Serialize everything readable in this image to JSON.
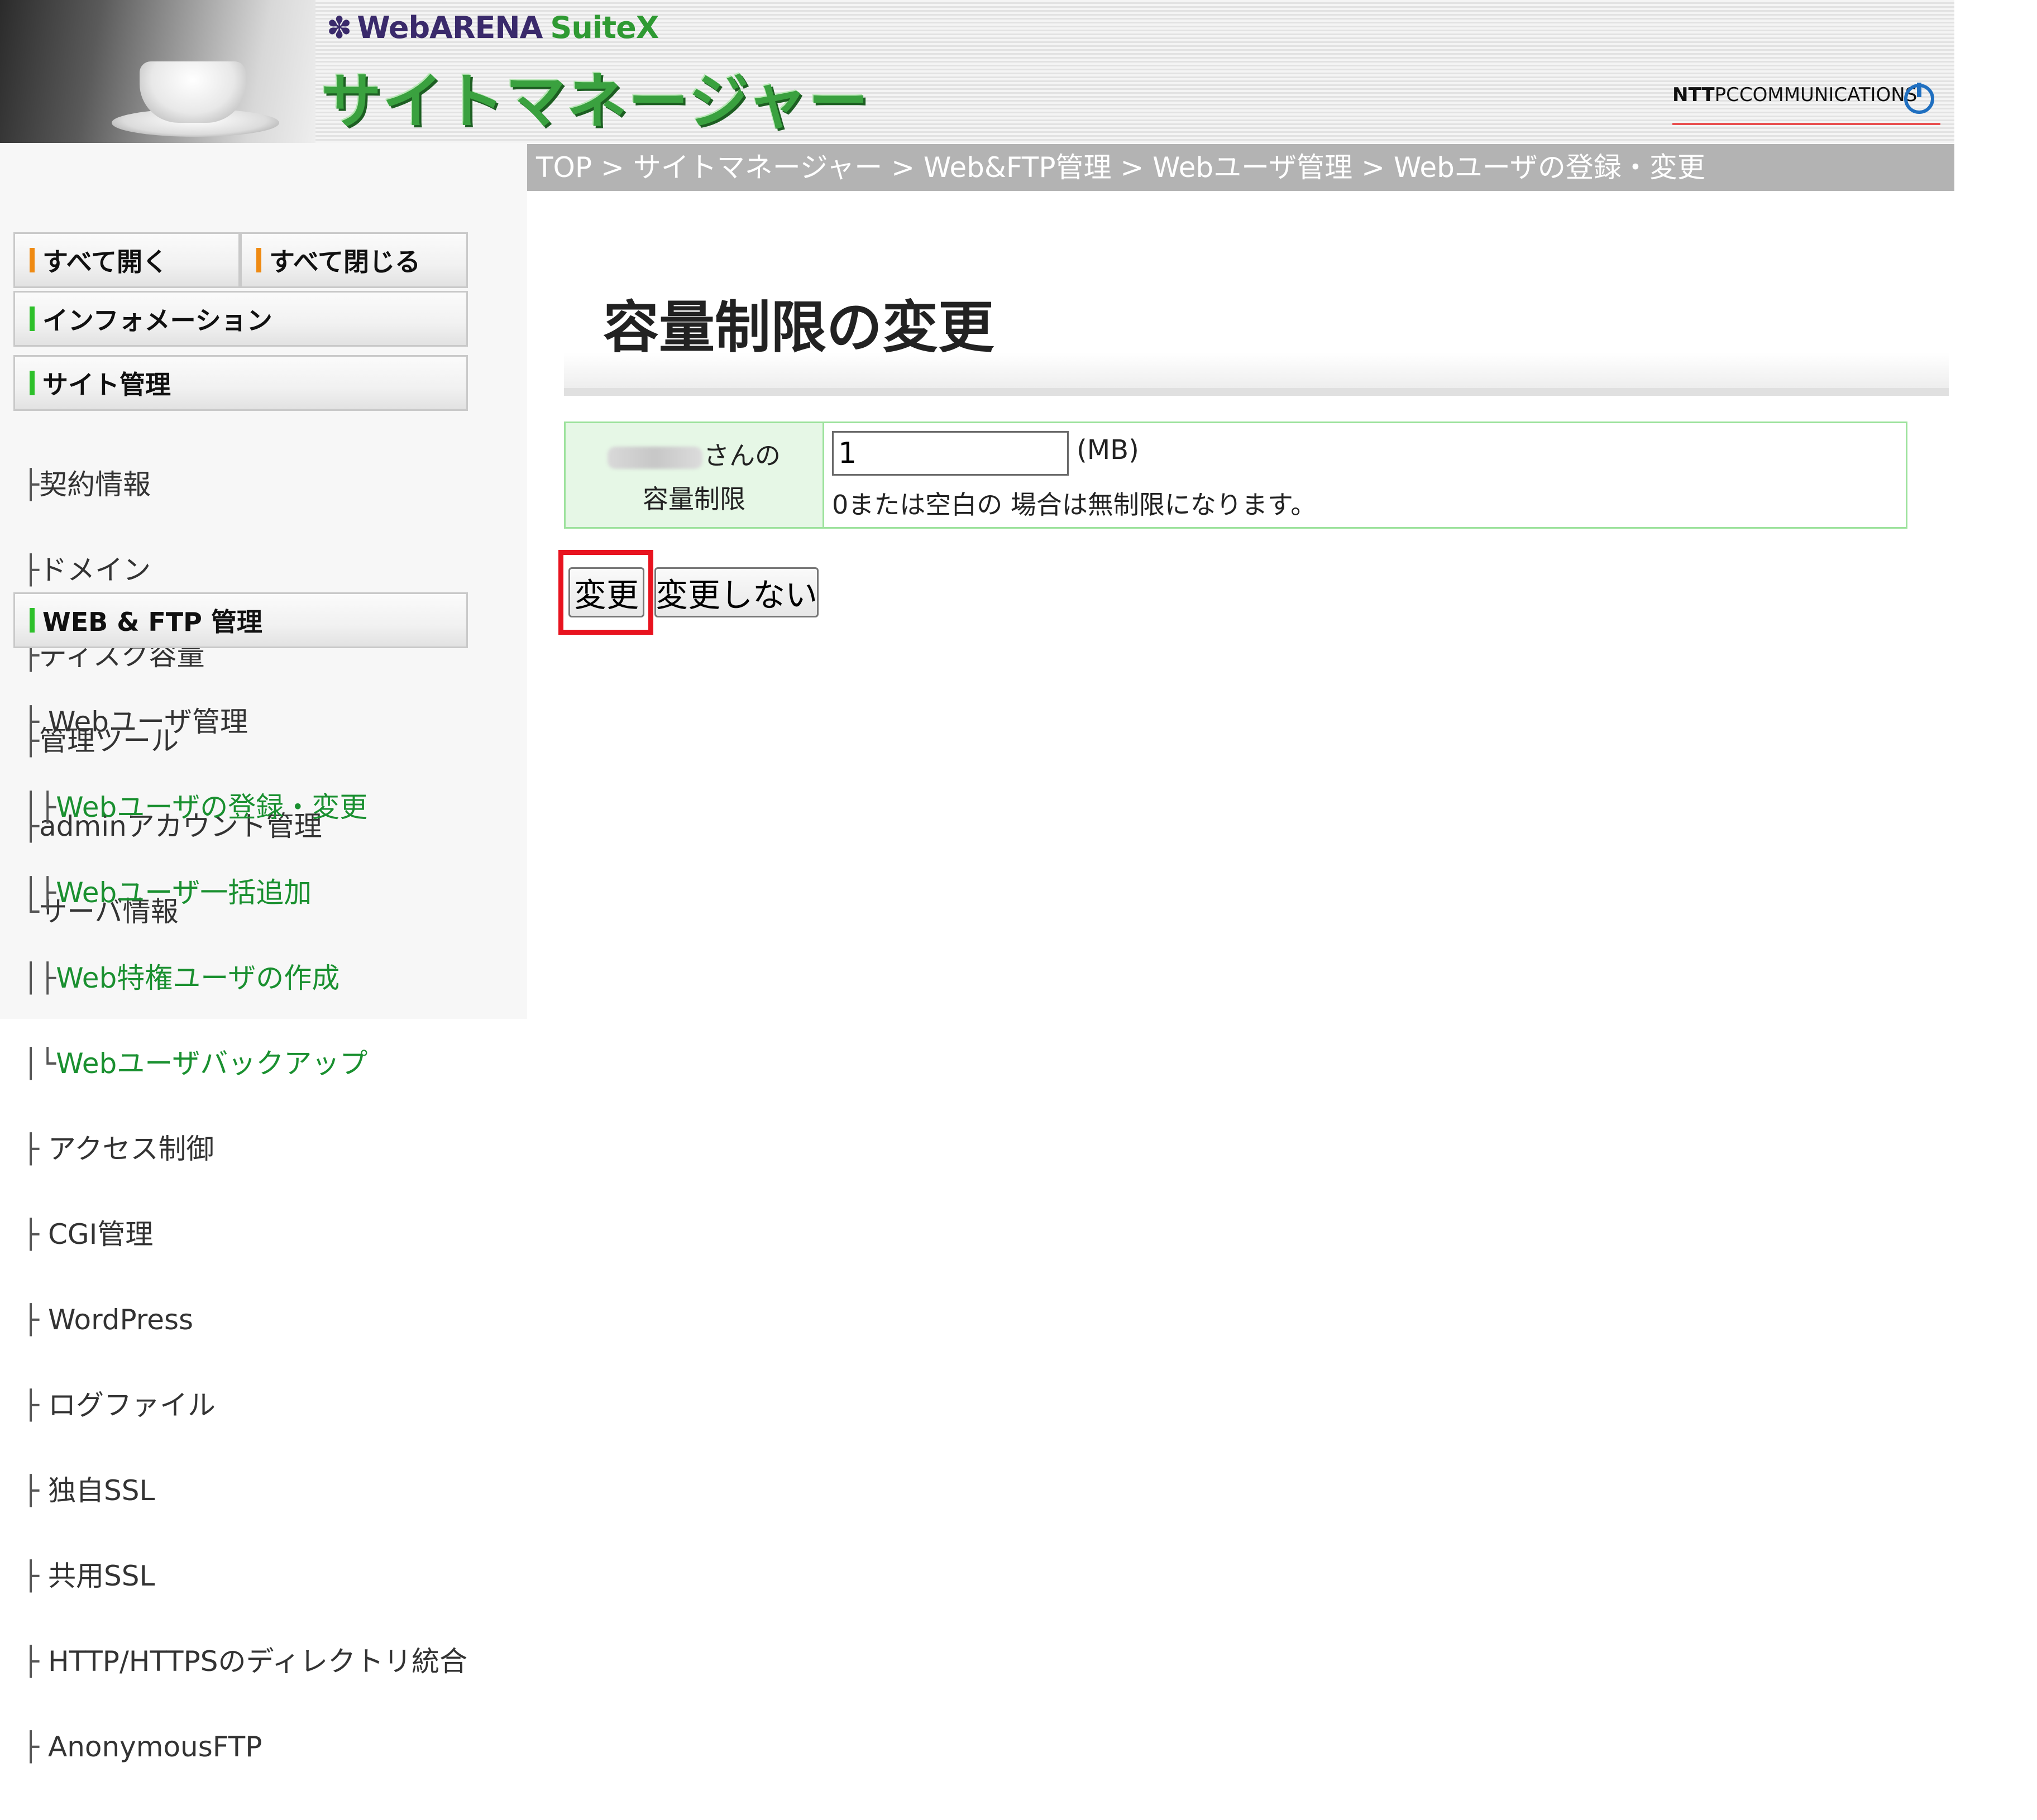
{
  "header": {
    "brand_small": "WebARENA",
    "brand_suite": "SuiteX",
    "brand_title": "サイトマネージャー",
    "company_bold": "NTT",
    "company_rest": "PCCOMMUNICATIONS"
  },
  "breadcrumb": {
    "text": "TOP > サイトマネージャー > Web&FTP管理 > Webユーザ管理 > Webユーザの登録・変更"
  },
  "sidebar": {
    "open_all": "すべて開く",
    "close_all": "すべて閉じる",
    "information": "インフォメーション",
    "site_management": "サイト管理",
    "site_items": [
      {
        "glyph": "├",
        "label": "契約情報"
      },
      {
        "glyph": "├",
        "label": "ドメイン"
      },
      {
        "glyph": "├",
        "label": "ディスク容量"
      },
      {
        "glyph": "├",
        "label": "管理ツール"
      },
      {
        "glyph": "├",
        "label": "adminアカウント管理"
      },
      {
        "glyph": "└",
        "label": "サーバ情報"
      }
    ],
    "web_ftp": "WEB & FTP 管理",
    "web_ftp_items": [
      {
        "glyph": "├ ",
        "label": "Webユーザ管理",
        "link": false
      },
      {
        "glyph": "│├",
        "label": "Webユーザの登録・変更",
        "link": true
      },
      {
        "glyph": "│├",
        "label": "Webユーザ一括追加",
        "link": true
      },
      {
        "glyph": "│├",
        "label": "Web特権ユーザの作成",
        "link": true
      },
      {
        "glyph": "│└",
        "label": "Webユーザバックアップ",
        "link": true
      },
      {
        "glyph": "├ ",
        "label": "アクセス制御",
        "link": false
      },
      {
        "glyph": "├ ",
        "label": "CGI管理",
        "link": false
      },
      {
        "glyph": "├ ",
        "label": "WordPress",
        "link": false
      },
      {
        "glyph": "├ ",
        "label": "ログファイル",
        "link": false
      },
      {
        "glyph": "├ ",
        "label": "独自SSL",
        "link": false
      },
      {
        "glyph": "├ ",
        "label": "共用SSL",
        "link": false
      },
      {
        "glyph": "├ ",
        "label": "HTTP/HTTPSのディレクトリ統合",
        "link": false
      },
      {
        "glyph": "├ ",
        "label": "AnonymousFTP",
        "link": false
      }
    ]
  },
  "main": {
    "title": "容量制限の変更",
    "label_line1": "さんの",
    "label_line2": "容量制限",
    "quota_value": "1",
    "unit": "(MB)",
    "hint": "0または空白の 場合は無制限になります。",
    "change_button": "変更",
    "cancel_button": "変更しない"
  },
  "colors": {
    "accent_green": "#3aa13f",
    "link_green": "#1a9030",
    "highlight_red": "#e8131f",
    "breadcrumb_gray": "#b3b3b3"
  }
}
